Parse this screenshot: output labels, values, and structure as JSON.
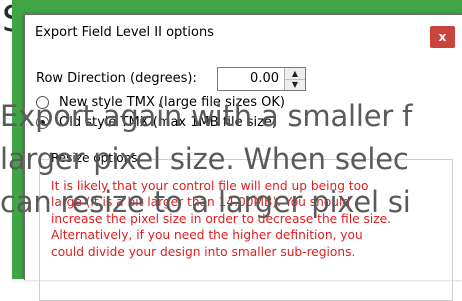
{
  "background": {
    "heading": "S"
  },
  "dialog": {
    "title": "Export Field Level II options",
    "close_label": "x",
    "row_direction": {
      "label": "Row Direction (degrees):",
      "value": "0.00"
    },
    "radios": [
      {
        "label": "New style TMX (large file sizes OK)",
        "checked": false
      },
      {
        "label": "Old style TMX (max 1MB file size)",
        "checked": true
      }
    ],
    "resize": {
      "legend": "Resize options",
      "warning_lines": [
        "It is likely that your control file will end up being too",
        "large (it is a bit larger than 14.00MB). You should",
        "increase the pixel size in order to decrease the file size.",
        "Alternatively, if you need the higher definition, you",
        "could divide your design into smaller sub-regions."
      ]
    }
  },
  "overlay": {
    "lines": [
      "Export again with a smaller f",
      "larger pixel size. When selec",
      "can resize to a larger pixel si"
    ]
  },
  "colors": {
    "frame_green": "#3fa545",
    "close_red": "#c8443c",
    "warning_red": "#e11d1d"
  }
}
